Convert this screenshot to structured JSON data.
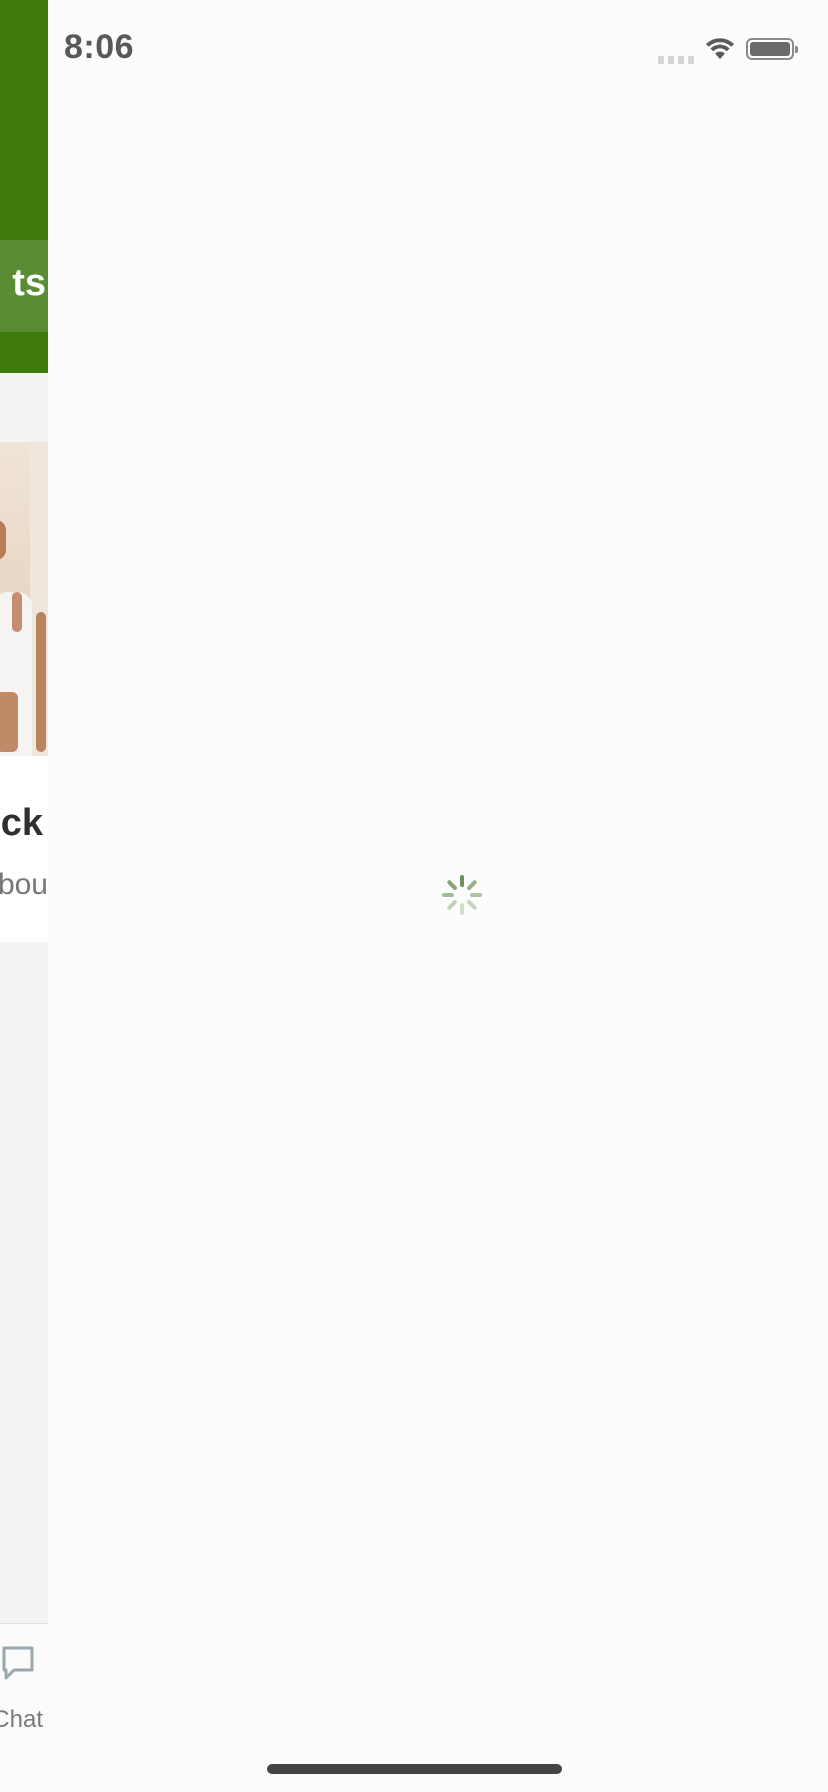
{
  "status_bar": {
    "time": "8:06",
    "signal_icon": "cellular-signal-icon",
    "wifi_icon": "wifi-icon",
    "battery_icon": "battery-icon"
  },
  "background_page": {
    "header_color": "#3f7b0b",
    "tab_label_fragment": "ts",
    "card_title_fragment": "ck",
    "card_subtitle_fragment": "bou",
    "tabbar": {
      "chat_label_fragment": "Chat",
      "chat_icon": "chat-bubble-icon"
    }
  },
  "loading": {
    "indicator": "activity-spinner-icon",
    "accent_color": "#7a9a68"
  },
  "home_indicator": "home-indicator"
}
